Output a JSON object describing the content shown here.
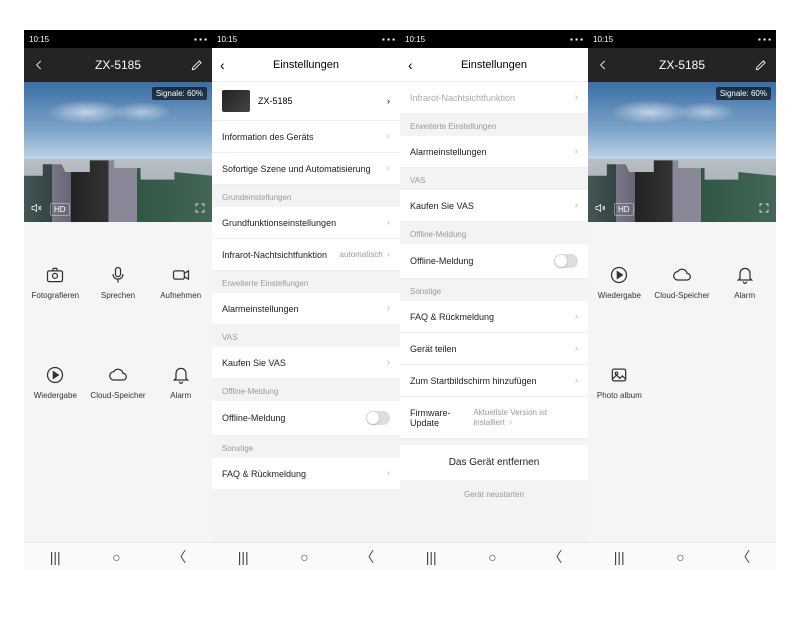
{
  "status": {
    "time": "10:15",
    "icons": "⬚ ✆ ⌁"
  },
  "camera": {
    "title": "ZX-5185",
    "signal": "Signale: 60%",
    "hd": "HD"
  },
  "tiles1": [
    {
      "name": "fotografieren",
      "label": "Fotografieren",
      "icon": "camera"
    },
    {
      "name": "sprechen",
      "label": "Sprechen",
      "icon": "mic"
    },
    {
      "name": "aufnehmen",
      "label": "Aufnehmen",
      "icon": "record"
    },
    {
      "name": "wiedergabe",
      "label": "Wiedergabe",
      "icon": "play"
    },
    {
      "name": "cloud-speicher",
      "label": "Cloud-Speicher",
      "icon": "cloud"
    },
    {
      "name": "alarm",
      "label": "Alarm",
      "icon": "bell"
    }
  ],
  "tiles4": [
    {
      "name": "wiedergabe",
      "label": "Wiedergabe",
      "icon": "play"
    },
    {
      "name": "cloud-speicher",
      "label": "Cloud-Speicher",
      "icon": "cloud"
    },
    {
      "name": "alarm",
      "label": "Alarm",
      "icon": "bell"
    },
    {
      "name": "photo-album",
      "label": "Photo album",
      "icon": "photo"
    }
  ],
  "settings": {
    "title": "Einstellungen",
    "device_name": "ZX-5185",
    "info": "Information des Geräts",
    "scene": "Sofortige Szene und Automatisierung",
    "sect_basic": "Grundeinstellungen",
    "basic_func": "Grundfunktionseinstellungen",
    "infrared": "Infrarot-Nachtsichtfunktion",
    "infrared_val": "automatisch",
    "sect_adv": "Erweiterte Einstellungen",
    "alarm": "Alarmeinstellungen",
    "sect_vas": "VAS",
    "buy_vas": "Kaufen Sie VAS",
    "sect_offline": "Offline-Meldung",
    "offline": "Offline-Meldung",
    "sect_other": "Sonstige",
    "faq": "FAQ & Rückmeldung",
    "share": "Gerät teilen",
    "homescreen": "Zum Startbildschirm hinzufügen",
    "firmware": "Firmware-Update",
    "firmware_val": "Aktuellste Version ist installiert",
    "remove": "Das Gerät entfernen",
    "restart": "Gerät neustarten"
  }
}
